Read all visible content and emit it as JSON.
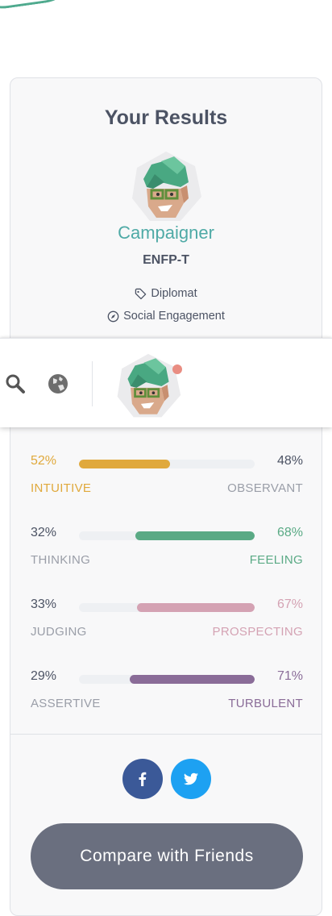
{
  "results": {
    "title": "Your Results",
    "type_name": "Campaigner",
    "type_code": "ENFP-T",
    "role": "Diplomat",
    "strategy": "Social Engagement"
  },
  "icons": {
    "role": "tag-icon",
    "strategy": "compass-icon",
    "search": "search-icon",
    "globe": "globe-icon",
    "facebook": "facebook-icon",
    "twitter": "twitter-icon"
  },
  "traits": [
    {
      "left_pct": "52%",
      "right_pct": "48%",
      "left_label": "INTUITIVE",
      "right_label": "OBSERVANT",
      "dominant": "left",
      "value": 52,
      "color": "#e0a93c"
    },
    {
      "left_pct": "32%",
      "right_pct": "68%",
      "left_label": "THINKING",
      "right_label": "FEELING",
      "dominant": "right",
      "value": 68,
      "color": "#5aaa85"
    },
    {
      "left_pct": "33%",
      "right_pct": "67%",
      "left_label": "JUDGING",
      "right_label": "PROSPECTING",
      "dominant": "right",
      "value": 67,
      "color": "#d4a2b3"
    },
    {
      "left_pct": "29%",
      "right_pct": "71%",
      "left_label": "ASSERTIVE",
      "right_label": "TURBULENT",
      "dominant": "right",
      "value": 71,
      "color": "#8a6c98"
    }
  ],
  "colors": {
    "accent": "#4faaa6",
    "muted": "#9a9ea8",
    "dark": "#4c5364",
    "notification_dot": "#e98d82",
    "facebook": "#3b5998",
    "twitter": "#1da1f2",
    "button": "#6a6f7f"
  },
  "buttons": {
    "compare": "Compare with Friends"
  }
}
